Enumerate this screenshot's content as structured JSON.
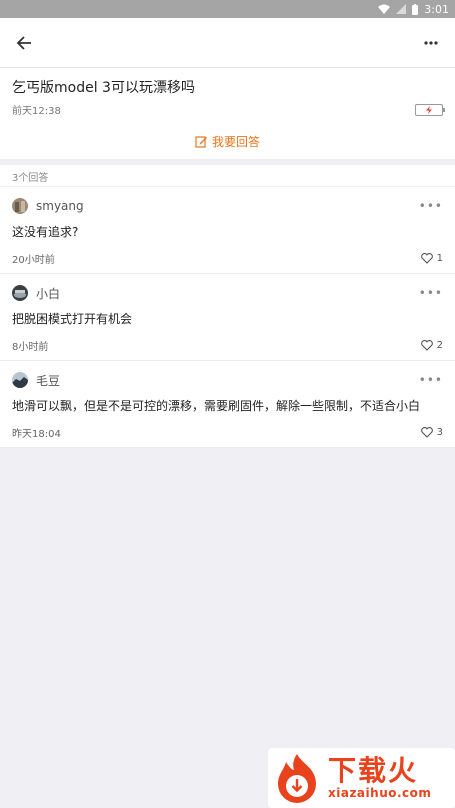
{
  "statusbar": {
    "time": "3:01"
  },
  "question": {
    "title": "乞丐版model 3可以玩漂移吗",
    "time": "前天12:38",
    "answer_label": "我要回答"
  },
  "answers_count": "3个回答",
  "answers": [
    {
      "user": "smyang",
      "body": "这没有追求?",
      "time": "20小时前",
      "likes": "1"
    },
    {
      "user": "小白",
      "body": "把脱困模式打开有机会",
      "time": "8小时前",
      "likes": "2"
    },
    {
      "user": "毛豆",
      "body": "地滑可以飘，但是不是可控的漂移，需要刷固件，解除一些限制，不适合小白",
      "time": "昨天18:04",
      "likes": "3"
    }
  ],
  "watermark": {
    "main": "下载火",
    "sub": "xiazaihuo.com"
  },
  "colors": {
    "accent": "#e8761c",
    "brand": "#e8431c"
  }
}
